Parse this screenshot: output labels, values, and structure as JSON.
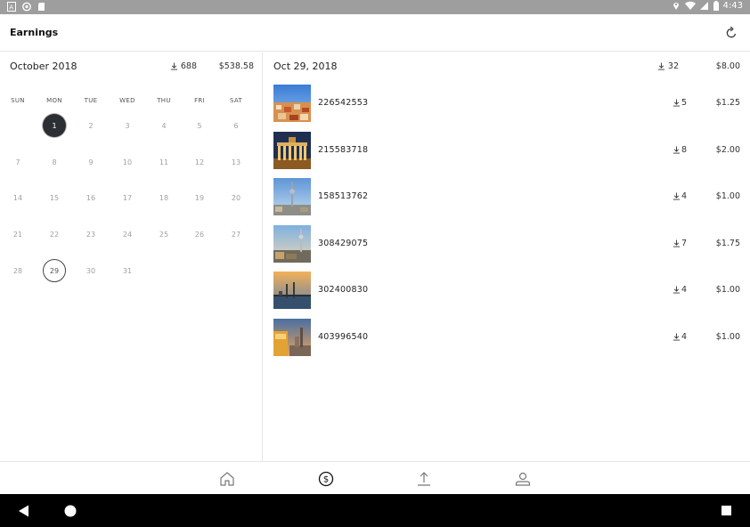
{
  "status": {
    "time": "4:43",
    "left_icons": [
      "a-icon",
      "circle-icon",
      "sd-card-icon"
    ],
    "right_icons": [
      "location-icon",
      "wifi-icon",
      "signal-icon",
      "battery-icon"
    ]
  },
  "app_bar": {
    "title": "Earnings",
    "refresh_icon": "refresh-icon"
  },
  "calendar": {
    "month": "October 2018",
    "downloads": "688",
    "earnings": "$538.58",
    "weekdays": [
      "SUN",
      "MON",
      "TUE",
      "WED",
      "THU",
      "FRI",
      "SAT"
    ],
    "weeks": [
      [
        "",
        "1",
        "2",
        "3",
        "4",
        "5",
        "6"
      ],
      [
        "7",
        "8",
        "9",
        "10",
        "11",
        "12",
        "13"
      ],
      [
        "14",
        "15",
        "16",
        "17",
        "18",
        "19",
        "20"
      ],
      [
        "21",
        "22",
        "23",
        "24",
        "25",
        "26",
        "27"
      ],
      [
        "28",
        "29",
        "30",
        "31",
        "",
        "",
        ""
      ]
    ],
    "selected_day": "1",
    "today_day": "29"
  },
  "detail": {
    "date": "Oct 29, 2018",
    "downloads": "32",
    "earnings": "$8.00",
    "rows": [
      {
        "id": "226542553",
        "downloads": "5",
        "amount": "$1.25"
      },
      {
        "id": "215583718",
        "downloads": "8",
        "amount": "$2.00"
      },
      {
        "id": "158513762",
        "downloads": "4",
        "amount": "$1.00"
      },
      {
        "id": "308429075",
        "downloads": "7",
        "amount": "$1.75"
      },
      {
        "id": "302400830",
        "downloads": "4",
        "amount": "$1.00"
      },
      {
        "id": "403996540",
        "downloads": "4",
        "amount": "$1.00"
      }
    ]
  },
  "bottom_nav": [
    "home-icon",
    "earnings-icon",
    "upload-icon",
    "profile-icon"
  ],
  "system_nav": [
    "back-icon",
    "home-circle-icon",
    "recents-icon"
  ],
  "colors": {
    "status_bar": "#9e9e9e",
    "selected_day": "#2b2f33",
    "divider": "#e6e6e6"
  }
}
